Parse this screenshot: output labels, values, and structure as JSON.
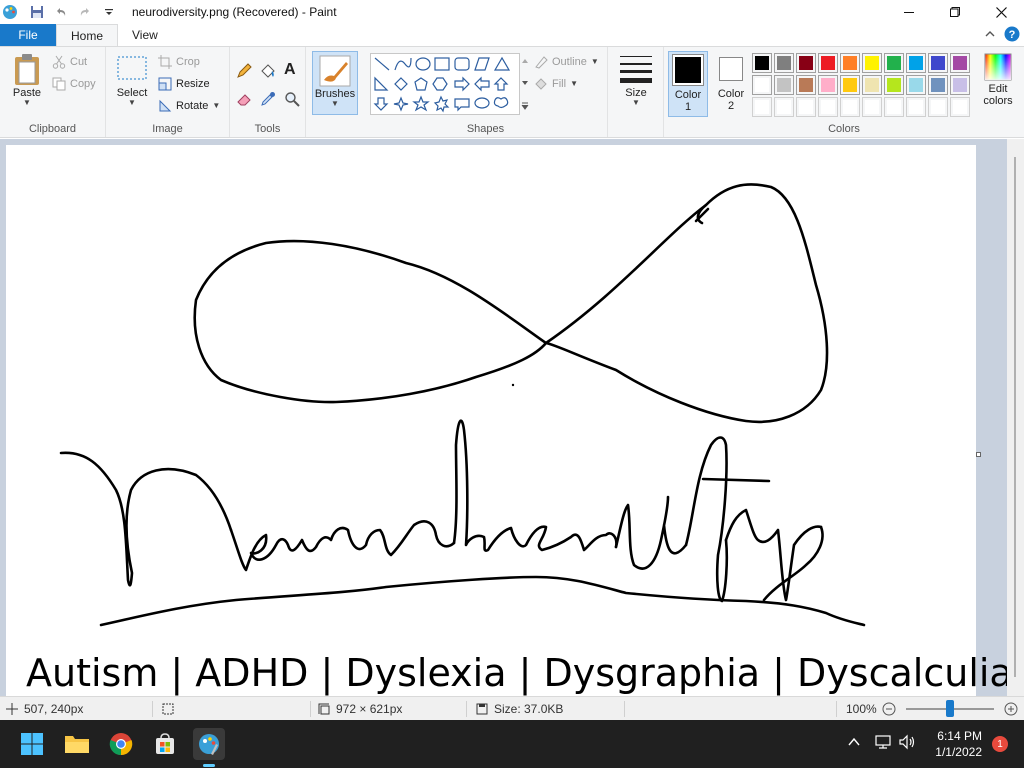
{
  "window": {
    "title": "neurodiversity.png (Recovered) - Paint"
  },
  "tabs": {
    "file": "File",
    "home": "Home",
    "view": "View"
  },
  "ribbon": {
    "clipboard": {
      "label": "Clipboard",
      "paste": "Paste",
      "cut": "Cut",
      "copy": "Copy"
    },
    "image": {
      "label": "Image",
      "select": "Select",
      "crop": "Crop",
      "resize": "Resize",
      "rotate": "Rotate"
    },
    "tools": {
      "label": "Tools",
      "text_glyph": "A"
    },
    "brushes": {
      "label": "Brushes"
    },
    "shapes": {
      "label": "Shapes",
      "outline": "Outline",
      "fill": "Fill"
    },
    "size": {
      "label": "Size"
    },
    "colors": {
      "label": "Colors",
      "color1": "Color",
      "color1_num": "1",
      "color2": "Color",
      "color2_num": "2",
      "edit_colors_1": "Edit",
      "edit_colors_2": "colors",
      "color1_value": "#000000",
      "color2_value": "#ffffff",
      "palette_row1": [
        "#000000",
        "#7f7f7f",
        "#880015",
        "#ed1c24",
        "#ff7f27",
        "#fff200",
        "#22b14c",
        "#00a2e8",
        "#3f48cc",
        "#a349a4"
      ],
      "palette_row2": [
        "#ffffff",
        "#c3c3c3",
        "#b97a57",
        "#ffaec9",
        "#ffc90e",
        "#efe4b0",
        "#b5e61d",
        "#99d9ea",
        "#7092be",
        "#c8bfe7"
      ],
      "palette_row3": [
        "#ffffff",
        "#ffffff",
        "#ffffff",
        "#ffffff",
        "#ffffff",
        "#ffffff",
        "#ffffff",
        "#ffffff",
        "#ffffff",
        "#ffffff"
      ]
    }
  },
  "canvas": {
    "caption": "Autism | ADHD | Dyslexia | Dysgraphia | Dyscalculia"
  },
  "status": {
    "cursor_pos": "507, 240px",
    "image_size": "972 × 621px",
    "file_size": "Size: 37.0KB",
    "zoom": "100%"
  },
  "taskbar": {
    "time": "6:14 PM",
    "date": "1/1/2022",
    "notifications": "1"
  }
}
